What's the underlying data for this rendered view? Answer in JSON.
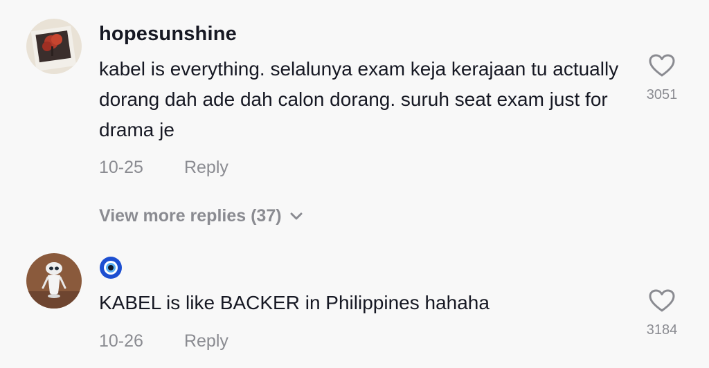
{
  "comments": [
    {
      "username": "hopesunshine",
      "avatar_icon": "red-tree-photo-avatar",
      "text": "kabel is everything. selalunya exam keja kerajaan tu actually dorang dah ade dah calon dorang. suruh seat exam just for drama je",
      "date": "10-25",
      "reply_label": "Reply",
      "like_count": "3051"
    },
    {
      "username_icon": "evil-eye-emoji",
      "avatar_icon": "robot-toy-avatar",
      "text": "KABEL is like BACKER in Philippines hahaha",
      "date": "10-26",
      "reply_label": "Reply",
      "like_count": "3184"
    }
  ],
  "view_more_replies": "View more replies (37)",
  "colors": {
    "text": "#161823",
    "secondary": "#8a8b91",
    "background": "#f8f8f8"
  }
}
